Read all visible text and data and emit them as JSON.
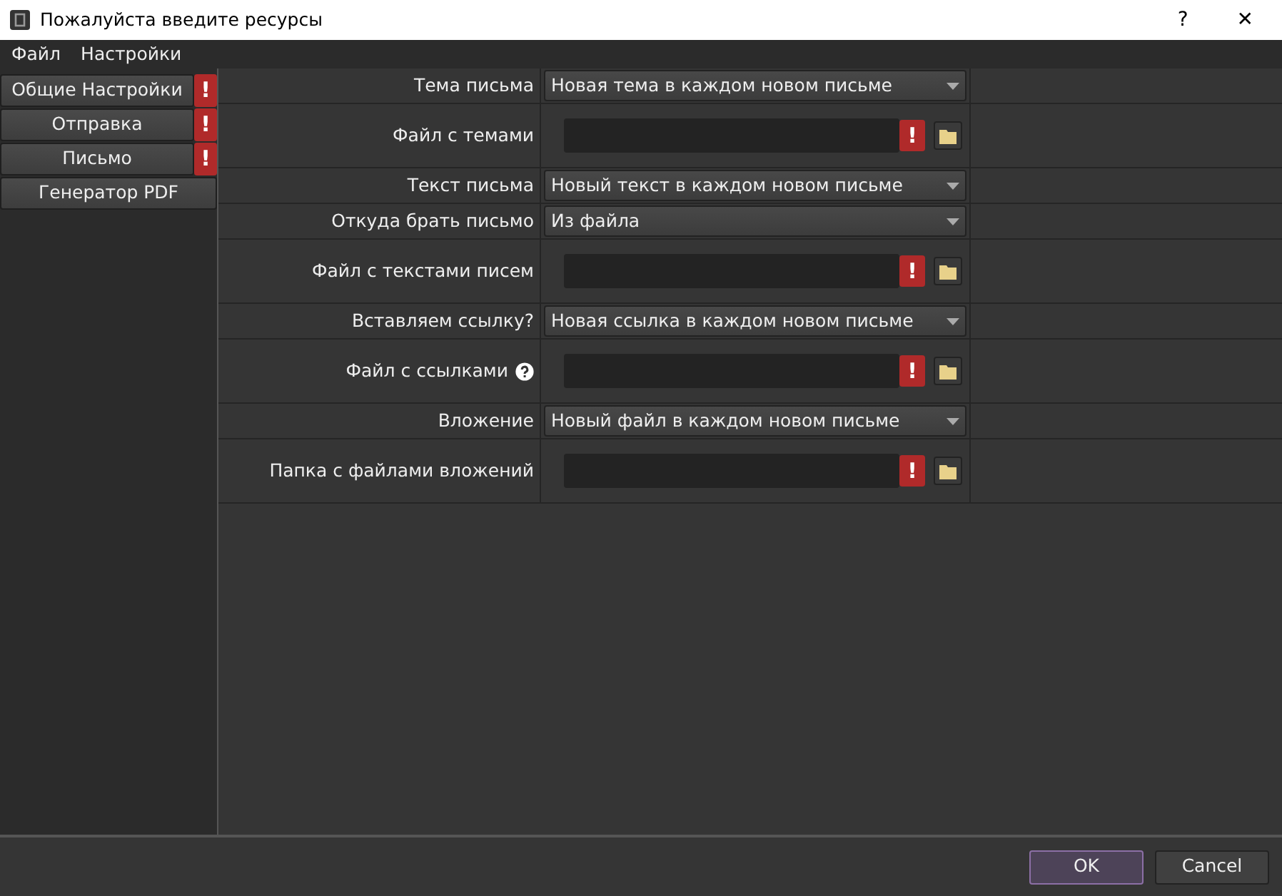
{
  "window": {
    "title": "Пожалуйста введите ресурсы",
    "help_glyph": "?",
    "close_glyph": "✕"
  },
  "menu": [
    "Файл",
    "Настройки"
  ],
  "sidebar": {
    "items": [
      {
        "label": "Общие Настройки",
        "warning": true,
        "warning_glyph": "!"
      },
      {
        "label": "Отправка",
        "warning": true,
        "warning_glyph": "!"
      },
      {
        "label": "Письмо",
        "warning": true,
        "warning_glyph": "!"
      },
      {
        "label": "Генератор PDF",
        "warning": false
      }
    ]
  },
  "form": {
    "rows": [
      {
        "kind": "select",
        "label": "Тема письма",
        "value": "Новая тема в каждом новом письме"
      },
      {
        "kind": "file",
        "label": "Файл с темами",
        "help": false,
        "warning": true,
        "warning_glyph": "!"
      },
      {
        "kind": "select",
        "label": "Текст письма",
        "value": "Новый текст в каждом новом письме"
      },
      {
        "kind": "select",
        "label": "Откуда брать письмо",
        "value": "Из файла"
      },
      {
        "kind": "file",
        "label": "Файл с текстами писем",
        "help": false,
        "warning": true,
        "warning_glyph": "!"
      },
      {
        "kind": "select",
        "label": "Вставляем ссылку?",
        "value": "Новая ссылка в каждом новом письме"
      },
      {
        "kind": "file",
        "label": "Файл с ссылками",
        "help": true,
        "warning": true,
        "warning_glyph": "!"
      },
      {
        "kind": "select",
        "label": "Вложение",
        "value": "Новый файл в каждом новом письме"
      },
      {
        "kind": "file",
        "label": "Папка с файлами вложений",
        "help": false,
        "warning": true,
        "warning_glyph": "!"
      }
    ]
  },
  "buttons": [
    {
      "label": "OK",
      "default": true
    },
    {
      "label": "Cancel",
      "default": false
    }
  ]
}
